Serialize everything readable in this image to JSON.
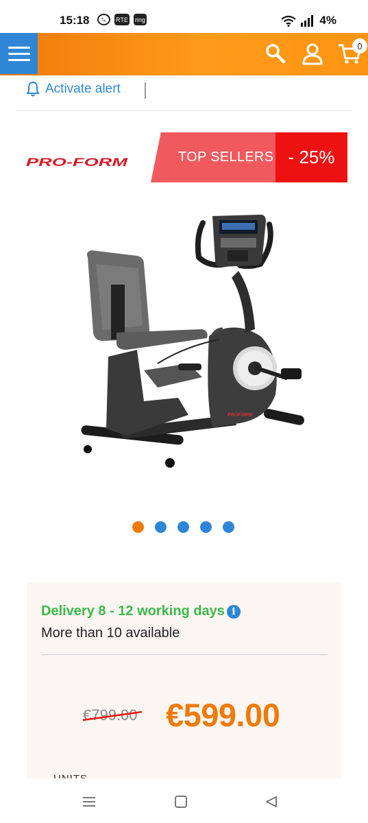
{
  "status_bar": {
    "time": "15:18",
    "notification_icons": [
      "whatsapp-icon",
      "rte-icon",
      "ring-icon"
    ],
    "rte_label": "RTE",
    "ring_label": "ring",
    "battery": "4%"
  },
  "header": {
    "menu_icon": "hamburger-icon",
    "search_icon": "search-icon",
    "account_icon": "user-icon",
    "cart_icon": "cart-icon",
    "cart_count": "0",
    "colors": {
      "brand_orange": "#f07a0a",
      "menu_blue": "#2f86d6"
    }
  },
  "alert": {
    "label": "Activate alert",
    "icon": "bell-icon"
  },
  "brand": {
    "logo_text": "PRO-FORM"
  },
  "promo": {
    "ribbon_label": "TOP SELLERS",
    "discount": "- 25%"
  },
  "product_image": {
    "description_icon": "recumbent-exercise-bike-image"
  },
  "carousel": {
    "dot_count": 5,
    "active_index": 0
  },
  "availability": {
    "delivery": "Delivery 8 - 12 working days",
    "stock": "More than 10 available",
    "info_icon": "info-icon"
  },
  "pricing": {
    "old_price": "€799.00",
    "new_price": "€599.00"
  },
  "units": {
    "label": "UNITS"
  },
  "nav_bar": {
    "icons": [
      "recent-apps-icon",
      "home-icon",
      "back-icon"
    ]
  }
}
